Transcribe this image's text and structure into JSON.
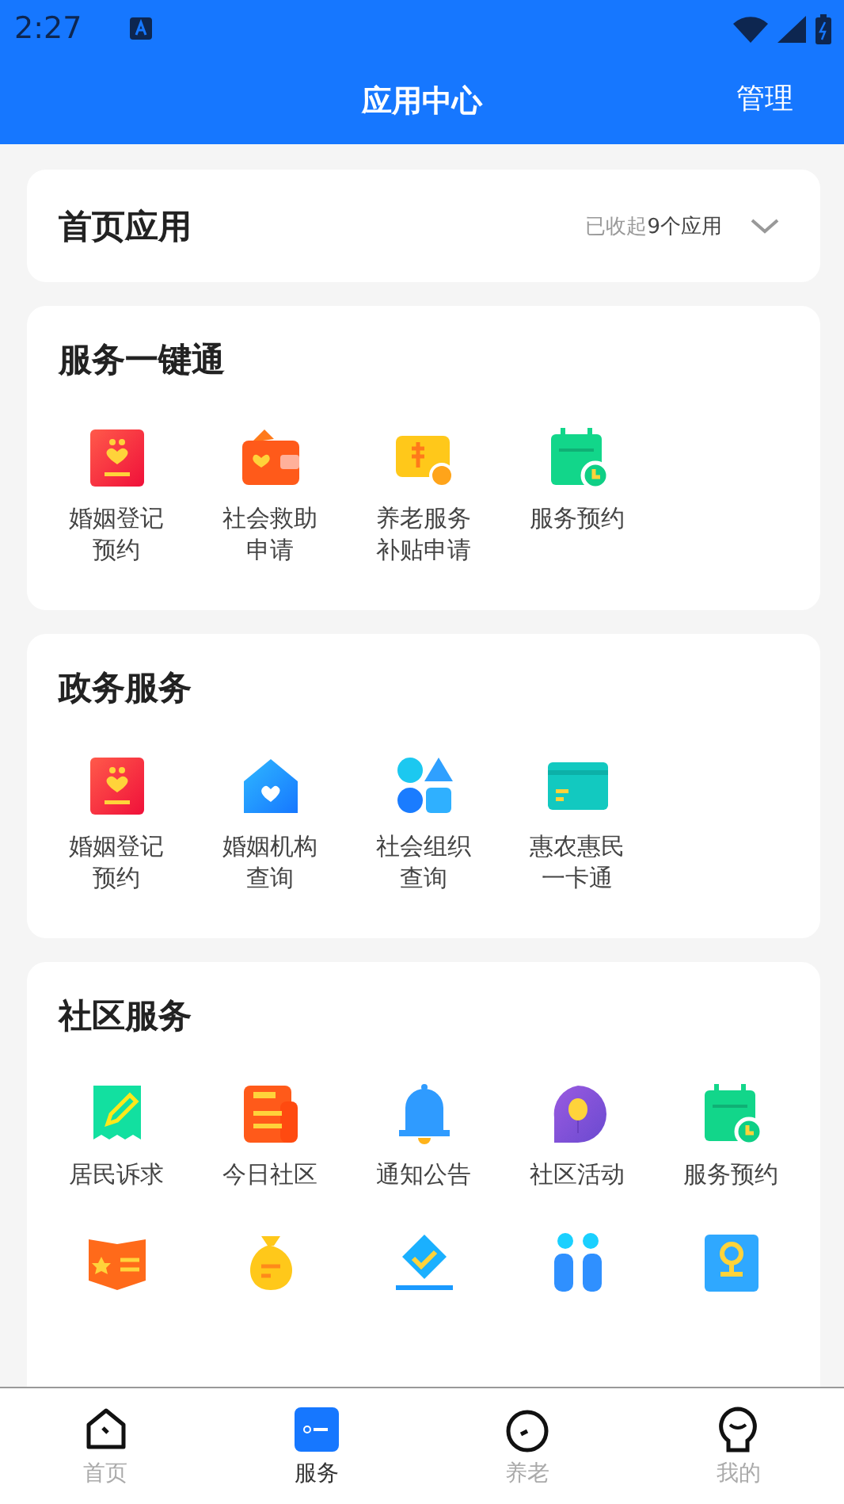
{
  "status_bar": {
    "time": "2:27"
  },
  "header": {
    "title": "应用中心",
    "action": "管理"
  },
  "home_apps": {
    "title": "首页应用",
    "summary": "已收起**9个应用**",
    "expanded": false
  },
  "sections": [
    {
      "title": "服务一键通",
      "apps": [
        {
          "kind": "labeled",
          "label": "婚姻登记预约"
        },
        {
          "kind": "labeled",
          "label": "社会救助申请"
        },
        {
          "kind": "labeled",
          "label": "养老服务补贴申请"
        },
        {
          "kind": "labeled",
          "label": "服务预约"
        }
      ]
    },
    {
      "title": "政务服务",
      "apps": [
        {
          "kind": "labeled",
          "label": "婚姻登记预约"
        },
        {
          "kind": "labeled",
          "label": "婚姻机构查询"
        },
        {
          "kind": "labeled",
          "label": "社会组织查询"
        },
        {
          "kind": "labeled",
          "label": "惠农惠民一卡通"
        }
      ]
    },
    {
      "title": "社区服务",
      "apps": [
        {
          "kind": "labeled",
          "label": "居民诉求"
        },
        {
          "kind": "labeled",
          "label": "今日社区"
        },
        {
          "kind": "labeled",
          "label": "通知公告"
        },
        {
          "kind": "labeled",
          "label": "社区活动"
        },
        {
          "kind": "labeled",
          "label": "服务预约"
        },
        {
          "kind": "icon_only"
        },
        {
          "kind": "icon_only"
        },
        {
          "kind": "icon_only"
        },
        {
          "kind": "icon_only"
        },
        {
          "kind": "icon_only"
        }
      ]
    }
  ],
  "tabs": [
    {
      "label": "首页",
      "selected": false
    },
    {
      "label": "服务",
      "selected": true
    },
    {
      "label": "养老",
      "selected": false
    },
    {
      "label": "我的",
      "selected": false
    }
  ]
}
